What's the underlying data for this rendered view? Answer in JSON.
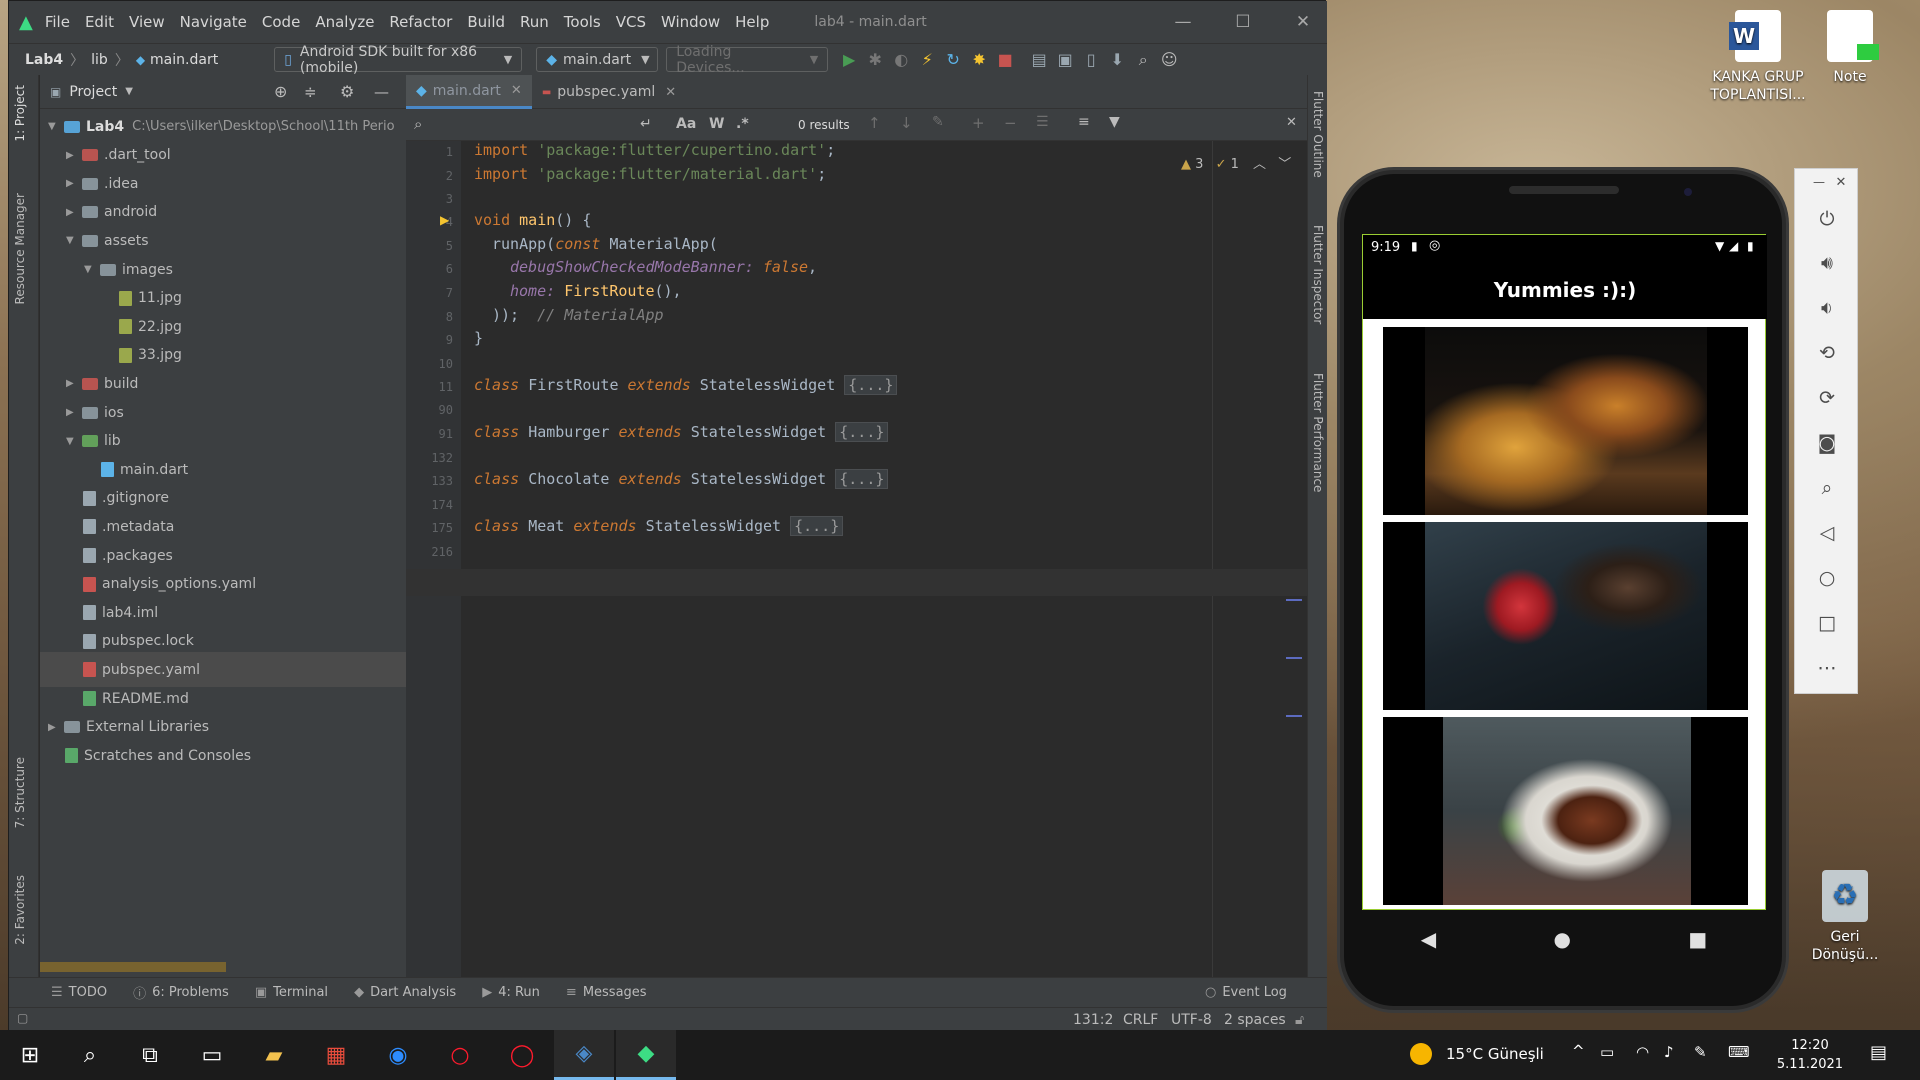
{
  "window": {
    "menu": [
      "File",
      "Edit",
      "View",
      "Navigate",
      "Code",
      "Analyze",
      "Refactor",
      "Build",
      "Run",
      "Tools",
      "VCS",
      "Window",
      "Help"
    ],
    "title": "lab4 - main.dart"
  },
  "navbar": {
    "breadcrumb": [
      "Lab4",
      "lib",
      "main.dart"
    ],
    "device": "Android SDK built for x86 (mobile)",
    "run_config": "main.dart",
    "devices_placeholder": "Loading Devices..."
  },
  "left_tool_tabs": [
    "1: Project",
    "Resource Manager",
    "7: Structure",
    "2: Favorites"
  ],
  "project_panel": {
    "title": "Project",
    "tree": [
      {
        "label": "Lab4",
        "suffix": "C:\\Users\\ilker\\Desktop\\School\\11th Perio",
        "depth": 0,
        "open": true,
        "kind": "module"
      },
      {
        "label": ".dart_tool",
        "depth": 1,
        "open": false,
        "kind": "folder-red"
      },
      {
        "label": ".idea",
        "depth": 1,
        "open": false,
        "kind": "folder"
      },
      {
        "label": "android",
        "depth": 1,
        "open": false,
        "kind": "folder"
      },
      {
        "label": "assets",
        "depth": 1,
        "open": true,
        "kind": "folder"
      },
      {
        "label": "images",
        "depth": 2,
        "open": true,
        "kind": "folder"
      },
      {
        "label": "11.jpg",
        "depth": 3,
        "kind": "img"
      },
      {
        "label": "22.jpg",
        "depth": 3,
        "kind": "img"
      },
      {
        "label": "33.jpg",
        "depth": 3,
        "kind": "img"
      },
      {
        "label": "build",
        "depth": 1,
        "open": false,
        "kind": "folder-red"
      },
      {
        "label": "ios",
        "depth": 1,
        "open": false,
        "kind": "folder"
      },
      {
        "label": "lib",
        "depth": 1,
        "open": true,
        "kind": "folder-green"
      },
      {
        "label": "main.dart",
        "depth": 2,
        "kind": "dart"
      },
      {
        "label": ".gitignore",
        "depth": 1,
        "kind": "file"
      },
      {
        "label": ".metadata",
        "depth": 1,
        "kind": "file"
      },
      {
        "label": ".packages",
        "depth": 1,
        "kind": "file"
      },
      {
        "label": "analysis_options.yaml",
        "depth": 1,
        "kind": "yml"
      },
      {
        "label": "lab4.iml",
        "depth": 1,
        "kind": "file"
      },
      {
        "label": "pubspec.lock",
        "depth": 1,
        "kind": "file"
      },
      {
        "label": "pubspec.yaml",
        "depth": 1,
        "kind": "yml",
        "selected": true
      },
      {
        "label": "README.md",
        "depth": 1,
        "kind": "md"
      },
      {
        "label": "External Libraries",
        "depth": 0,
        "open": false,
        "kind": "lib"
      },
      {
        "label": "Scratches and Consoles",
        "depth": 0,
        "kind": "scratch"
      }
    ]
  },
  "editor": {
    "tabs": [
      {
        "label": "main.dart",
        "active": true
      },
      {
        "label": "pubspec.yaml",
        "active": false
      }
    ],
    "find": {
      "results": "0 results",
      "case_label": "Aa",
      "word_label": "W",
      "regex_label": ".*"
    },
    "inspections": {
      "warnings": "3",
      "weak_warnings": "1"
    },
    "line_numbers": [
      "1",
      "2",
      "3",
      "4",
      "5",
      "6",
      "7",
      "8",
      "9",
      "10",
      "11",
      "90",
      "91",
      "132",
      "133",
      "174",
      "175",
      "216"
    ],
    "code": {
      "l1_kw": "import",
      "l1_str": "'package:flutter/cupertino.dart'",
      "l1_end": ";",
      "l2_kw": "import",
      "l2_str": "'package:flutter/material.dart'",
      "l2_end": ";",
      "l4_kw": "void",
      "l4_fn": "main",
      "l4_rest": "() {",
      "l5_call": "runApp(",
      "l5_kw": "const",
      "l5_cls": "MaterialApp(",
      "l6_named": "debugShowCheckedModeBanner:",
      "l6_val": "false",
      "l7_named": "home:",
      "l7_cls": "FirstRoute",
      "l8_close": "));",
      "l8_cmt": "// MaterialApp",
      "l9": "}",
      "c1_name": "FirstRoute",
      "c2_name": "Hamburger",
      "c3_name": "Chocolate",
      "c4_name": "Meat",
      "class_kw": "class",
      "extends_kw": "extends",
      "base": "StatelessWidget",
      "folded": "{...}"
    }
  },
  "right_tool_tabs": [
    "Flutter Outline",
    "Flutter Inspector",
    "Flutter Performance"
  ],
  "tool_windows": [
    {
      "label": "TODO",
      "icon": "list-icon"
    },
    {
      "label": "6: Problems",
      "icon": "info-icon"
    },
    {
      "label": "Terminal",
      "icon": "terminal-icon"
    },
    {
      "label": "Dart Analysis",
      "icon": "dart-icon"
    },
    {
      "label": "4: Run",
      "icon": "play-icon"
    },
    {
      "label": "Messages",
      "icon": "messages-icon"
    }
  ],
  "event_log": "Event Log",
  "status": {
    "position": "131:2",
    "line_sep": "CRLF",
    "encoding": "UTF-8",
    "indent": "2 spaces"
  },
  "phone": {
    "time": "9:19",
    "app_title": "Yummies :):)",
    "cards": [
      "hamburger-image",
      "chocolate-image",
      "meat-image"
    ]
  },
  "desktop_icons": [
    {
      "label": "KANKA GRUP TOPLANTISI...",
      "icon": "word-document-icon"
    },
    {
      "label": "Note",
      "icon": "note-icon"
    },
    {
      "label": "Geri Dönüşü...",
      "icon": "recycle-bin-icon"
    }
  ],
  "taskbar": {
    "weather": "15°C Güneşli",
    "time": "12:20",
    "date": "5.11.2021"
  },
  "colors": {
    "accent": "#4a88c7",
    "ide_bg": "#2b2b2b",
    "panel_bg": "#3c3f41",
    "keyword": "#cc7832",
    "string": "#6a8759",
    "function": "#ffc66d"
  }
}
